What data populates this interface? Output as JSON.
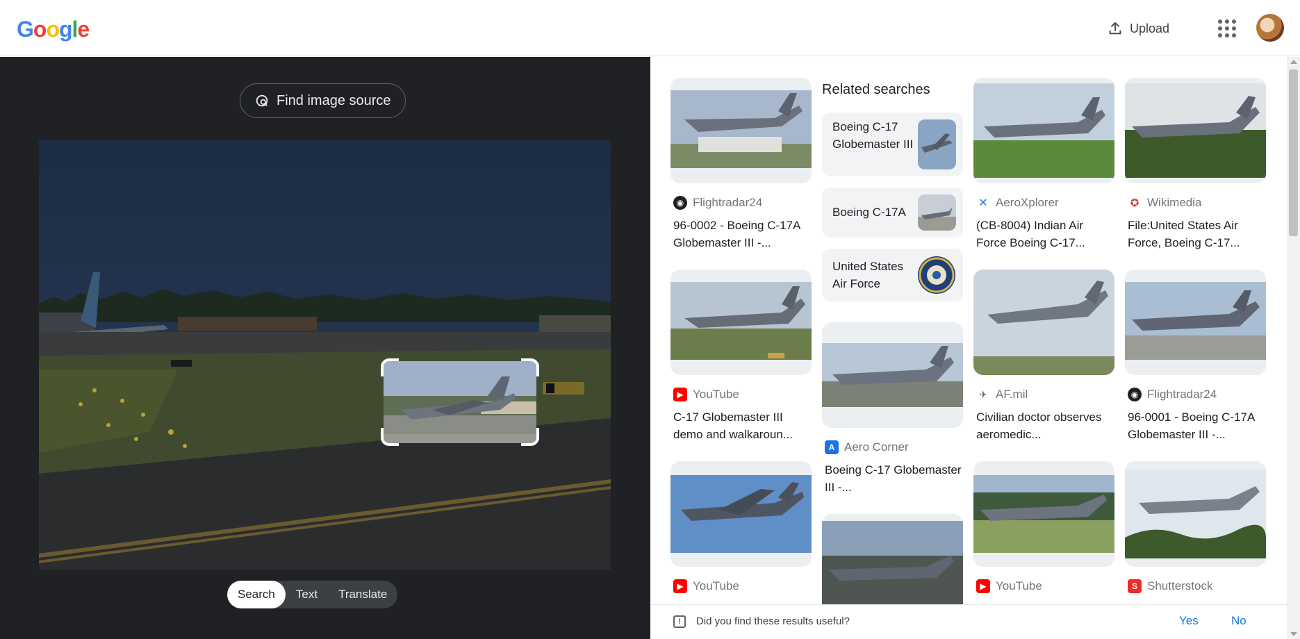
{
  "header": {
    "logo_letters": [
      "G",
      "o",
      "o",
      "g",
      "l",
      "e"
    ],
    "logo_colors": [
      "#4285f4",
      "#ea4335",
      "#fbbc05",
      "#4285f4",
      "#34a853",
      "#ea4335"
    ],
    "upload_label": "Upload"
  },
  "lens": {
    "find_source_label": "Find image source",
    "modes": [
      "Search",
      "Text",
      "Translate"
    ],
    "active_mode": "Search"
  },
  "related": {
    "heading": "Related searches",
    "items": [
      {
        "label": "Boeing C-17 Globemaster III"
      },
      {
        "label": "Boeing C-17A"
      },
      {
        "label": "United States Air Force"
      }
    ]
  },
  "results": [
    {
      "source": "Flightradar24",
      "icon": "flightradar-icon",
      "icon_color": "#202124",
      "title": "96-0002 - Boeing C-17A Globemaster III -..."
    },
    {
      "source": "AeroXplorer",
      "icon": "aeroxplorer-icon",
      "icon_color": "#1a73e8",
      "title": "(CB-8004) Indian Air Force Boeing C-17..."
    },
    {
      "source": "Wikimedia",
      "icon": "wikimedia-icon",
      "icon_color": "#d93025",
      "title": "File:United States Air Force, Boeing C-17..."
    },
    {
      "source": "YouTube",
      "icon": "youtube-icon",
      "icon_color": "#ff0000",
      "title": "C-17 Globemaster III demo and walkaroun..."
    },
    {
      "source": "Aero Corner",
      "icon": "aero-corner-icon",
      "icon_color": "#1a73e8",
      "title": "Boeing C-17 Globemaster III -..."
    },
    {
      "source": "AF.mil",
      "icon": "af-mil-icon",
      "icon_color": "#5f6368",
      "title": "Civilian doctor observes aeromedic..."
    },
    {
      "source": "Flightradar24",
      "icon": "flightradar-icon",
      "icon_color": "#202124",
      "title": "96-0001 - Boeing C-17A Globemaster III -..."
    },
    {
      "source": "YouTube",
      "icon": "youtube-icon",
      "icon_color": "#ff0000",
      "title": ""
    },
    {
      "source": "YouTube",
      "icon": "youtube-icon",
      "icon_color": "#ff0000",
      "title": ""
    },
    {
      "source": "Shutterstock",
      "icon": "shutterstock-icon",
      "icon_color": "#ee2b24",
      "title": ""
    }
  ],
  "feedback": {
    "question": "Did you find these results useful?",
    "yes": "Yes",
    "no": "No"
  }
}
